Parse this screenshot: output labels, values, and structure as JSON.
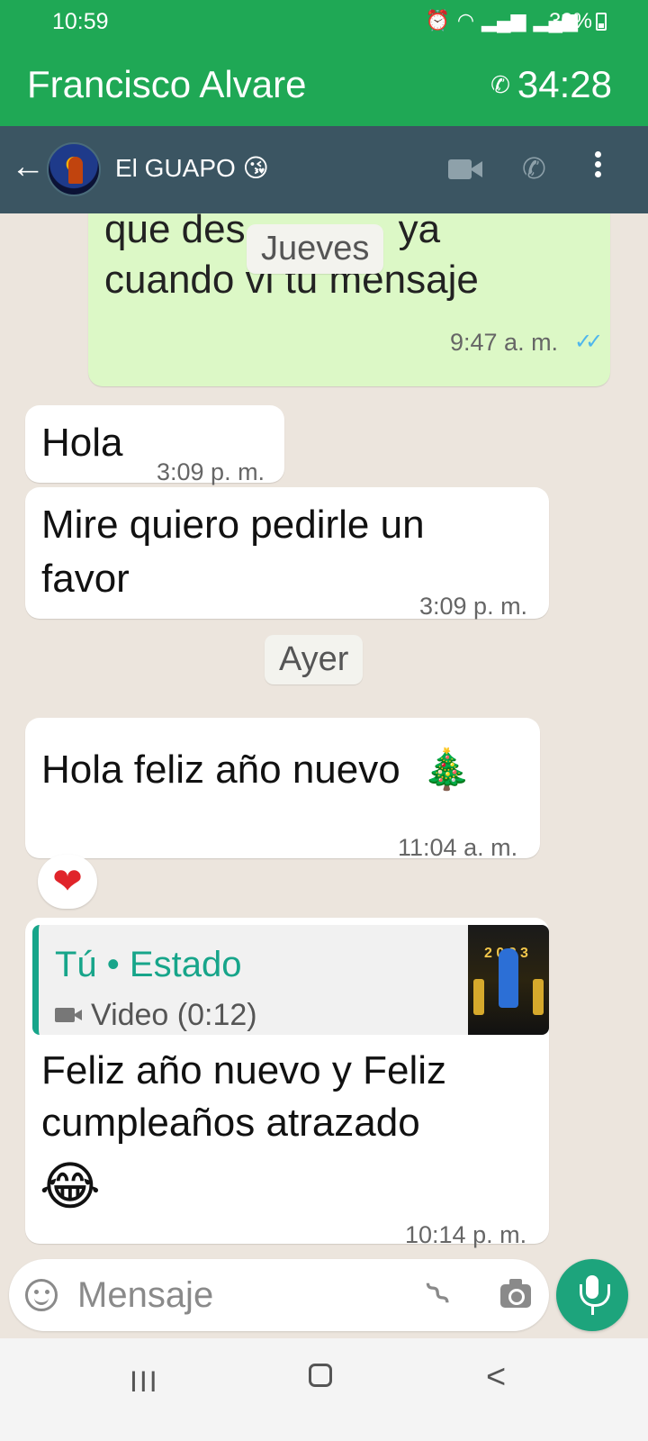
{
  "status_bar": {
    "time": "10:59",
    "battery": "30%"
  },
  "call_banner": {
    "caller_name": "Francisco Alvare",
    "duration": "34:28"
  },
  "header": {
    "contact_name": "El GUAPO",
    "contact_emoji": "😘"
  },
  "chat": {
    "messages": [
      {
        "dir": "out",
        "text_top": "que des",
        "text_top_after": "ya",
        "text_line2": "cuando vi tu mensaje",
        "time": "9:47 a. m.",
        "ticks": "✓✓"
      },
      {
        "dir": "in",
        "text": "Hola",
        "time": "3:09 p. m."
      },
      {
        "dir": "in",
        "text_line1": "Mire quiero pedirle un",
        "text_line2": "favor",
        "time": "3:09 p. m."
      },
      {
        "dir": "in",
        "text": "Hola feliz año nuevo",
        "emoji": "🎄",
        "time": "11:04 a. m.",
        "reaction": "❤"
      },
      {
        "dir": "in",
        "quote_author": "Tú • Estado",
        "quote_type": "Video (0:12)",
        "quote_thumb_text": "2 0 2 3",
        "text_line1": "Feliz año nuevo y Feliz",
        "text_line2": "cumpleaños atrazado",
        "emoji": "😂",
        "time": "10:14 p. m."
      }
    ],
    "date_chips": [
      "Jueves",
      "Ayer"
    ]
  },
  "composer": {
    "placeholder": "Mensaje"
  },
  "nav": {
    "recent": "III",
    "back": "<"
  },
  "colors": {
    "call_green": "#1fa855",
    "header": "#3b5562",
    "bubble_out": "#dcf8c6",
    "bubble_in": "#ffffff",
    "accent": "#1da47c",
    "ticks": "#4fb6ec"
  }
}
